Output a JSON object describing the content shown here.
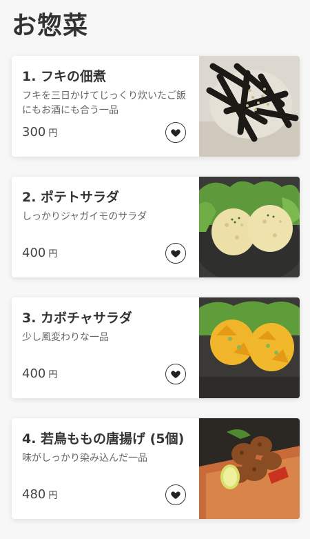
{
  "page": {
    "title": "お惣菜"
  },
  "items": [
    {
      "name": "1. フキの佃煮",
      "description": "フキを三日かけてじっくり炊いたご飯にもお酒にも合う一品",
      "price": "300",
      "currency": "円",
      "photo": "fuki-tsukudani-photo"
    },
    {
      "name": "2. ポテトサラダ",
      "description": "しっかりジャガイモのサラダ",
      "price": "400",
      "currency": "円",
      "photo": "potato-salad-photo"
    },
    {
      "name": "3. カボチャサラダ",
      "description": "少し風変わりな一品",
      "price": "400",
      "currency": "円",
      "photo": "pumpkin-salad-photo"
    },
    {
      "name": "4. 若鳥ももの唐揚げ (5個)",
      "description": "味がしっかり染み込んだ一品",
      "price": "480",
      "currency": "円",
      "photo": "karaage-photo"
    }
  ],
  "icons": {
    "favorite": "heart-icon"
  },
  "colors": {
    "background": "#f7f7f7",
    "card": "#ffffff",
    "text": "#333333"
  }
}
